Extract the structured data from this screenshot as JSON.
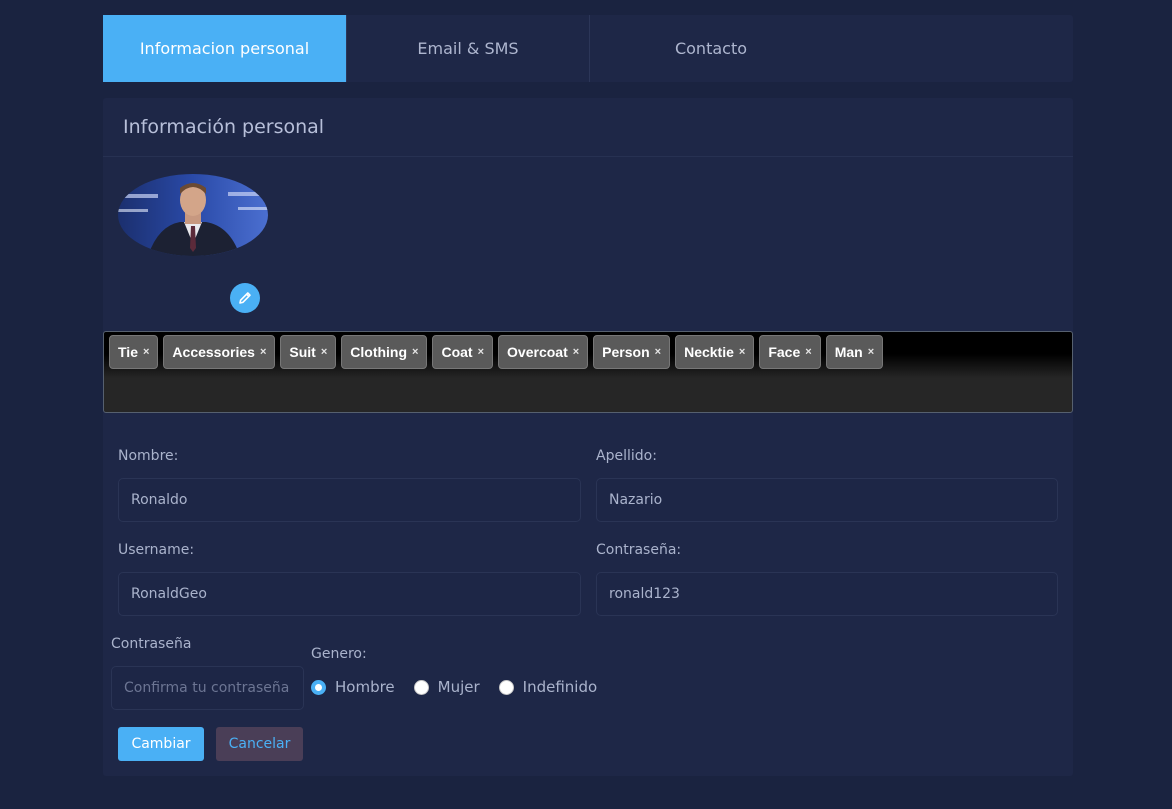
{
  "tabs": [
    "Informacion personal",
    "Email & SMS",
    "Contacto"
  ],
  "card": {
    "title": "Información personal"
  },
  "tags": [
    "Tie",
    "Accessories",
    "Suit",
    "Clothing",
    "Coat",
    "Overcoat",
    "Person",
    "Necktie",
    "Face",
    "Man"
  ],
  "tag_remove_glyph": "×",
  "form": {
    "nombre_label": "Nombre:",
    "nombre_value": "Ronaldo",
    "apellido_label": "Apellido:",
    "apellido_value": "Nazario",
    "username_label": "Username:",
    "username_value": "RonaldGeo",
    "password_label": "Contraseña:",
    "password_value": "ronald123",
    "confirm_label": "Contraseña",
    "confirm_placeholder": "Confirma tu contraseña",
    "gender_label": "Genero:",
    "gender_options": [
      "Hombre",
      "Mujer",
      "Indefinido"
    ],
    "gender_selected": "Hombre"
  },
  "buttons": {
    "save": "Cambiar",
    "cancel": "Cancelar"
  },
  "icons": {
    "edit": "pencil-icon",
    "avatar": "profile-photo"
  },
  "colors": {
    "accent": "#4ab0f5",
    "background": "#1a2340",
    "panel": "#1e2747",
    "cancel_bg": "#4a3e57"
  }
}
